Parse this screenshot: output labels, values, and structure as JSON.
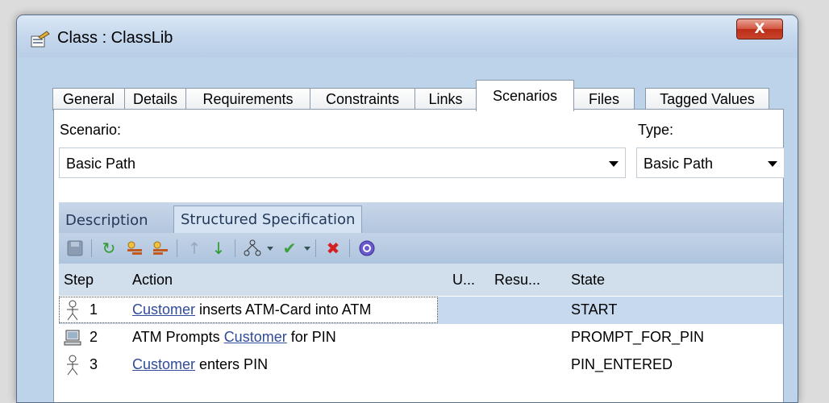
{
  "window": {
    "title": "Class : ClassLib",
    "close_label": "X"
  },
  "tabs": [
    {
      "label": "General"
    },
    {
      "label": "Details"
    },
    {
      "label": "Requirements"
    },
    {
      "label": "Constraints"
    },
    {
      "label": "Links"
    },
    {
      "label": "Scenarios",
      "active": true
    },
    {
      "label": "Files"
    },
    {
      "label": "Tagged Values"
    }
  ],
  "scenario": {
    "label": "Scenario:",
    "value": "Basic Path"
  },
  "type": {
    "label": "Type:",
    "value": "Basic Path"
  },
  "inner_tabs": [
    {
      "label": "Description"
    },
    {
      "label": "Structured Specification",
      "active": true
    }
  ],
  "toolbar": {
    "icons": [
      "save-icon",
      "refresh-icon",
      "new-step-icon",
      "insert-step-icon",
      "move-up-icon",
      "move-down-icon",
      "generate-diagram-icon",
      "validate-icon",
      "delete-icon",
      "help-icon"
    ]
  },
  "grid": {
    "headers": {
      "step": "Step",
      "action": "Action",
      "uses": "U...",
      "result": "Resu...",
      "state": "State"
    },
    "rows": [
      {
        "step": "1",
        "actor_icon": "actor-icon",
        "link": "Customer",
        "action_rest": " inserts ATM-Card into ATM",
        "state": "START",
        "selected": true
      },
      {
        "step": "2",
        "actor_icon": "system-icon",
        "action_pre": "ATM Prompts ",
        "link": "Customer",
        "action_rest": " for PIN",
        "state": "PROMPT_FOR_PIN"
      },
      {
        "step": "3",
        "actor_icon": "actor-icon",
        "link": "Customer",
        "action_rest": " enters PIN",
        "state": "PIN_ENTERED"
      }
    ]
  },
  "colors": {
    "link": "#2f4b9a",
    "selection": "#c7d9ef",
    "close_button": "#c8442c",
    "window_frame": "#bcd3ea"
  }
}
